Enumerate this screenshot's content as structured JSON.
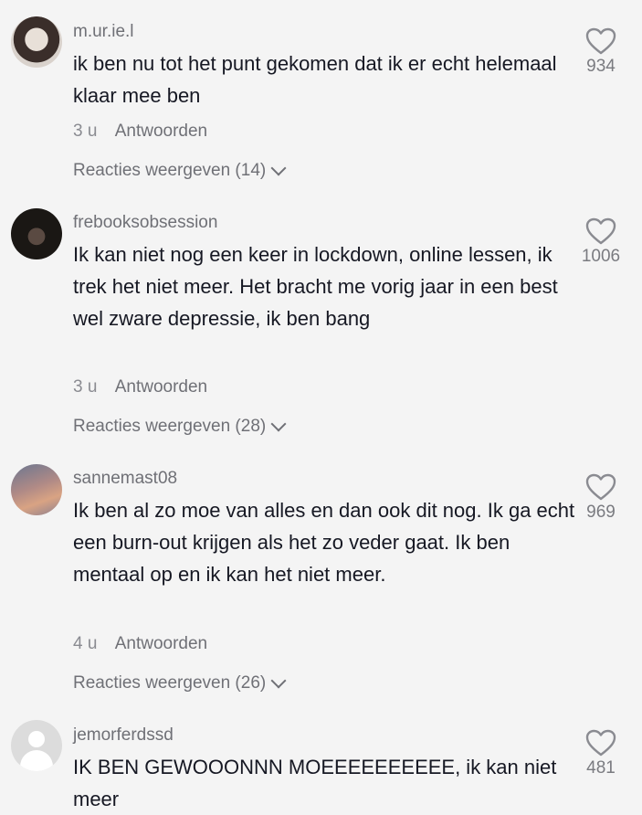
{
  "comments": [
    {
      "username": "m.ur.ie.l",
      "text": "ik ben nu tot het punt gekomen dat ik er echt helemaal klaar mee ben",
      "time": "3 u",
      "reply_label": "Antwoorden",
      "view_replies": "Reacties weergeven (14)",
      "likes": "934",
      "avatar": "user-photo-1"
    },
    {
      "username": "frebooksobsession",
      "text": "Ik kan niet nog een keer in lockdown, online lessen, ik trek het niet meer. Het bracht me vorig jaar in een best wel zware depressie, ik ben bang",
      "time": "3 u",
      "reply_label": "Antwoorden",
      "view_replies": "Reacties weergeven (28)",
      "likes": "1006",
      "avatar": "user-photo-2"
    },
    {
      "username": "sannemast08",
      "text": "Ik ben al zo moe van alles en dan ook dit nog. Ik ga echt een burn-out krijgen als het zo veder gaat. Ik ben mentaal op en ik kan het niet meer.",
      "time": "4 u",
      "reply_label": "Antwoorden",
      "view_replies": "Reacties weergeven (26)",
      "likes": "969",
      "avatar": "user-photo-3"
    },
    {
      "username": "jemorferdssd",
      "text": "IK BEN GEWOOONNN MOEEEEEEEEEE, ik kan niet meer",
      "likes": "481",
      "avatar": "default-avatar-icon"
    }
  ],
  "colors": {
    "background": "#f4f4f4",
    "text": "#161823",
    "muted": "#6f7076"
  }
}
